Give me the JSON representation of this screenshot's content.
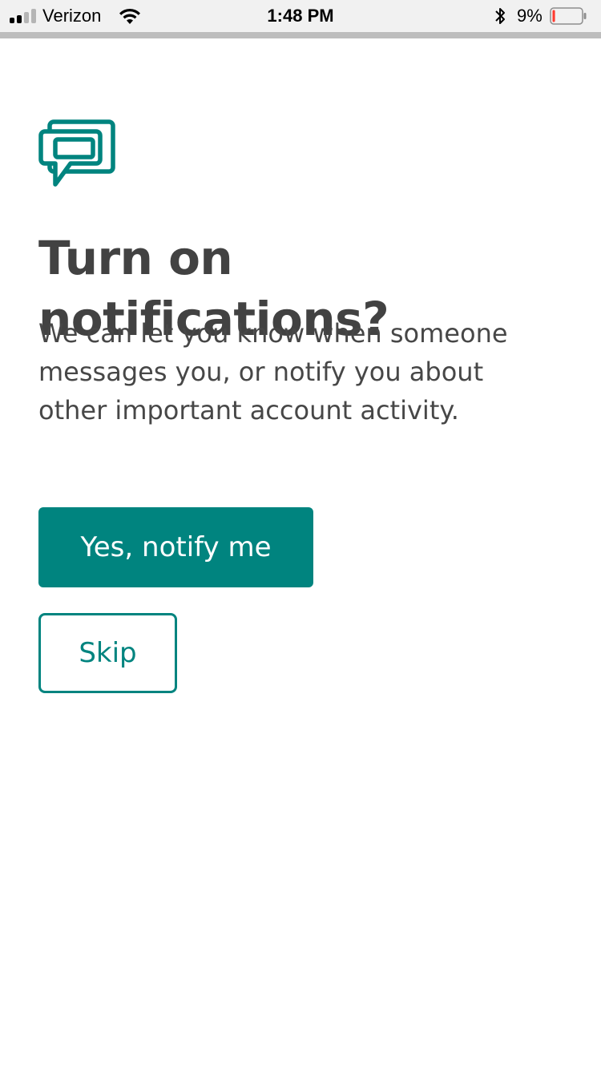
{
  "status_bar": {
    "carrier": "Verizon",
    "time": "1:48 PM",
    "battery_percent": "9%",
    "signal_bars_filled": 2,
    "signal_bars_total": 4,
    "battery_level": 0.09,
    "icons": [
      "signal-strength-icon",
      "wifi-icon",
      "bluetooth-icon",
      "battery-icon"
    ],
    "colors": {
      "background": "#f1f1f1",
      "battery_low": "#ff3b30"
    }
  },
  "content": {
    "icon": "chat-bubbles-icon",
    "title": "Turn on notifications?",
    "body": "We can let you know when someone messages you, or notify you about other important account activity."
  },
  "actions": {
    "primary_label": "Yes, notify me",
    "secondary_label": "Skip"
  },
  "colors": {
    "accent": "#00847f",
    "text_dark": "#424242",
    "background": "#ffffff"
  }
}
